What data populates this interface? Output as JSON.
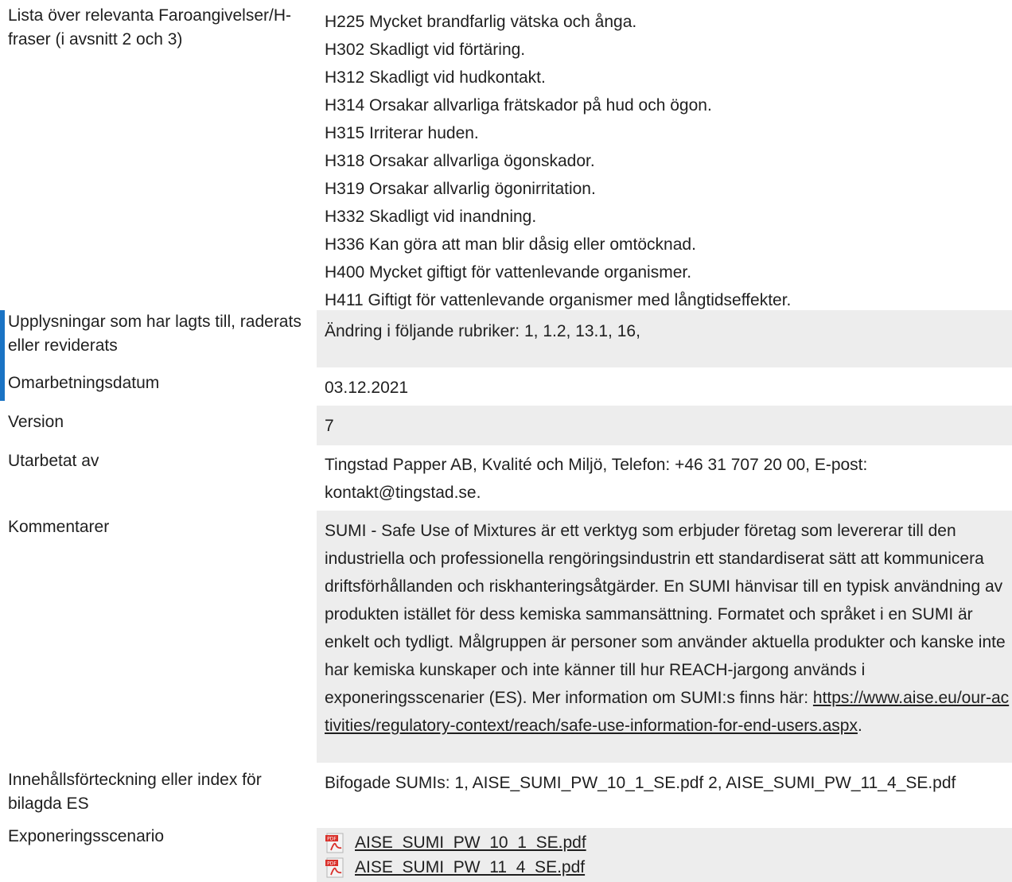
{
  "hazard": {
    "label": "Lista över relevanta Faroangivelser/H-fraser (i avsnitt 2 och 3)",
    "statements": [
      "H225 Mycket brandfarlig vätska och ånga.",
      "H302 Skadligt vid förtäring.",
      "H312 Skadligt vid hudkontakt.",
      "H314 Orsakar allvarliga frätskador på hud och ögon.",
      "H315 Irriterar huden.",
      "H318 Orsakar allvarliga ögonskador.",
      "H319 Orsakar allvarlig ögonirritation.",
      "H332 Skadligt vid inandning.",
      "H336 Kan göra att man blir dåsig eller omtöcknad.",
      "H400 Mycket giftigt för vattenlevande organismer.",
      "H411 Giftigt för vattenlevande organismer med långtidseffekter."
    ]
  },
  "changes": {
    "label": "Upplysningar som har lagts till, raderats eller reviderats",
    "value": "Ändring i följande rubriker: 1, 1.2, 13.1, 16,"
  },
  "revision_date": {
    "label": "Omarbetningsdatum",
    "value": "03.12.2021"
  },
  "version": {
    "label": "Version",
    "value": "7"
  },
  "prepared_by": {
    "label": "Utarbetat av",
    "value": "Tingstad Papper AB, Kvalité och Miljö, Telefon: +46 31 707 20 00, E-post: kontakt@tingstad.se."
  },
  "comments": {
    "label": "Kommentarer",
    "text": "SUMI - Safe Use of Mixtures är ett verktyg som erbjuder företag som levererar till den industriella och professionella rengöringsindustrin ett standardiserat sätt att kommunicera driftsförhållanden och riskhanteringsåtgärder. En SUMI hänvisar till en typisk användning av produkten istället för dess kemiska sammansättning. Formatet och språket i en SUMI är enkelt och tydligt. Målgruppen är personer som använder aktuella produkter och kanske inte har kemiska kunskaper och inte känner till hur REACH-jargong används i exponeringsscenarier (ES). Mer information om SUMI:s finns här: ",
    "link": "https://www.aise.eu/our-activities/regulatory-context/reach/safe-use-information-for-end-users.aspx",
    "suffix": "."
  },
  "toc": {
    "label": "Innehållsförteckning eller index för bilagda ES",
    "value": "Bifogade SUMIs: 1, AISE_SUMI_PW_10_1_SE.pdf 2, AISE_SUMI_PW_11_4_SE.pdf"
  },
  "exposure": {
    "label": "Exponeringsscenario",
    "files": [
      "AISE_SUMI_PW_10_1_SE.pdf",
      "AISE_SUMI_PW_11_4_SE.pdf"
    ]
  },
  "colors": {
    "accent": "#1a73c4",
    "shade": "#ededed",
    "pdf_red": "#d9302a"
  },
  "icons": [
    "pdf-file-icon"
  ]
}
